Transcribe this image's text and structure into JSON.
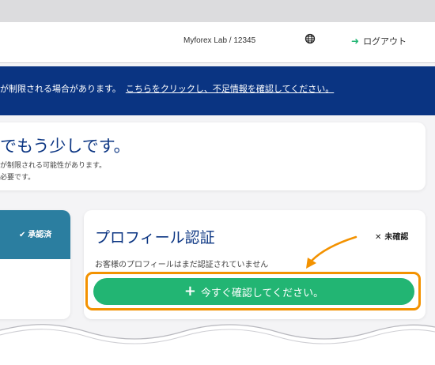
{
  "header": {
    "account": "Myforex Lab / 12345",
    "globe_icon": "globe-icon",
    "logout_icon": "logout-icon",
    "logout_label": "ログアウト"
  },
  "banner": {
    "text": "が制限される場合があります。",
    "link": "こちらをクリックし、不足情報を確認してください。"
  },
  "card_top": {
    "title": "でもう少しです。",
    "line1": "が制限される可能性があります。",
    "line2": "必要です。"
  },
  "card_left": {
    "badge": "承認済"
  },
  "card_profile": {
    "title": "プロフィール認証",
    "badge": "未確認",
    "description": "お客様のプロフィールはまだ認証されていません",
    "cta": "今すぐ確認してください。"
  },
  "colors": {
    "navy": "#0a3482",
    "green": "#22b573",
    "orange": "#f39200"
  }
}
